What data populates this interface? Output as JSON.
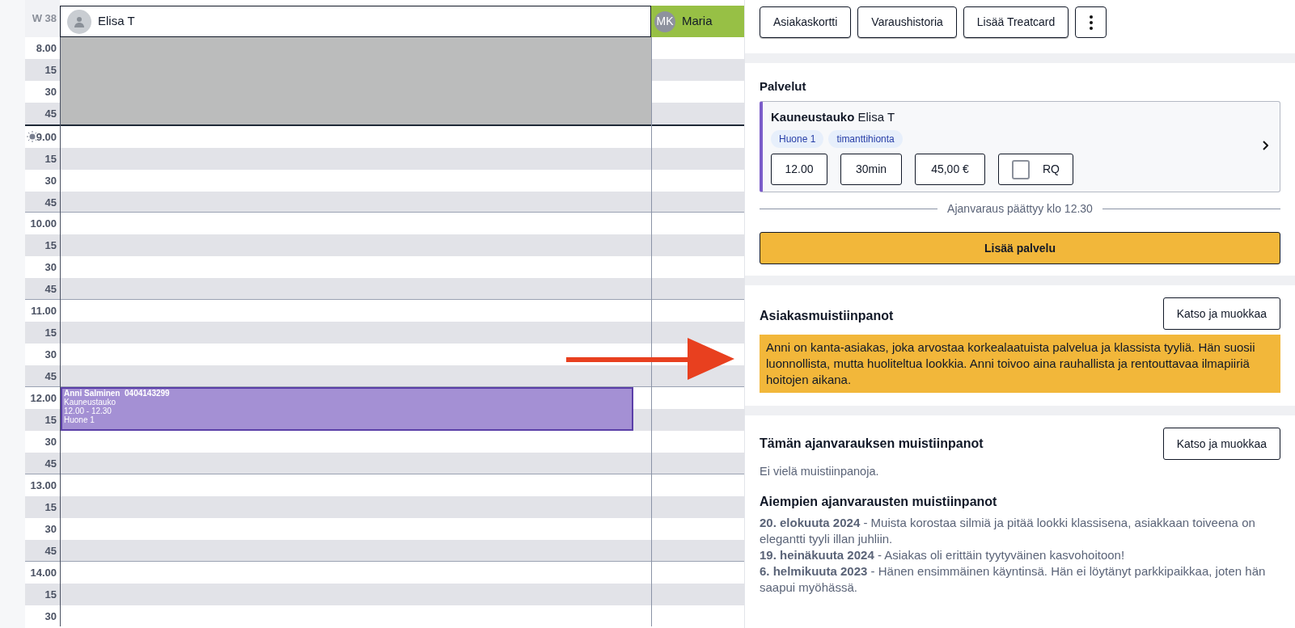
{
  "calendar": {
    "week": "W 38",
    "columns": [
      {
        "name": "Elisa T",
        "kind": "photo"
      },
      {
        "name": "Maria",
        "initials": "MK",
        "kind": "initials"
      }
    ],
    "hours": [
      {
        "label": "8.00",
        "quarters": [
          "15",
          "30",
          "45"
        ],
        "blocked": true,
        "now": false
      },
      {
        "label": "9.00",
        "quarters": [
          "15",
          "30",
          "45"
        ],
        "blocked": false,
        "now": true
      },
      {
        "label": "10.00",
        "quarters": [
          "15",
          "30",
          "45"
        ],
        "blocked": false,
        "now": false
      },
      {
        "label": "11.00",
        "quarters": [
          "15",
          "30",
          "45"
        ],
        "blocked": false,
        "now": false
      },
      {
        "label": "12.00",
        "quarters": [
          "15",
          "30",
          "45"
        ],
        "blocked": false,
        "now": false,
        "event": {
          "title": "Anni Salminen  0404143299",
          "lines": [
            "Kauneustauko",
            "12.00 - 12.30",
            "Huone 1"
          ]
        }
      },
      {
        "label": "13.00",
        "quarters": [
          "15",
          "30",
          "45"
        ],
        "blocked": false,
        "now": false
      },
      {
        "label": "14.00",
        "quarters": [
          "15",
          "30"
        ],
        "blocked": false,
        "now": false
      }
    ]
  },
  "toolbar": {
    "buttons": [
      "Asiakaskortti",
      "Varaushistoria",
      "Lisää Treatcard"
    ]
  },
  "services": {
    "title": "Palvelut",
    "service": {
      "name": "Kauneustauko",
      "staff": "Elisa T",
      "tags": [
        "Huone 1",
        "timanttihionta"
      ],
      "time": "12.00",
      "duration": "30min",
      "price": "45,00 €",
      "rq": {
        "label": "RQ",
        "checked": false
      }
    },
    "ends": "Ajanvaraus päättyy klo 12.30",
    "add_button": "Lisää palvelu"
  },
  "customer_notes": {
    "title": "Asiakasmuistiinpanot",
    "button": "Katso ja muokkaa",
    "text": "Anni on kanta-asiakas, joka arvostaa korkealaatuista palvelua ja klassista tyyliä. Hän suosii luonnollista, mutta huoliteltua lookkia. Anni toivoo aina rauhallista ja rentouttavaa ilmapiiriä hoitojen aikana."
  },
  "booking_notes": {
    "title": "Tämän ajanvarauksen muistiinpanot",
    "button": "Katso ja muokkaa",
    "empty": "Ei vielä muistiinpanoja.",
    "history_title": "Aiempien ajanvarausten muistiinpanot",
    "history": [
      "**20. elokuuta 2024** - Muista korostaa silmiä ja pitää lookki klassisena, asiakkaan toiveena on elegantti tyyli illan juhliin.",
      "**19. heinäkuuta 2024** - Asiakas oli erittäin tyytyväinen kasvohoitoon!",
      "**6. helmikuuta 2023** - Hänen ensimmäinen käyntinsä. Hän ei löytänyt parkkipaikkaa, joten hän saapui myöhässä."
    ]
  }
}
